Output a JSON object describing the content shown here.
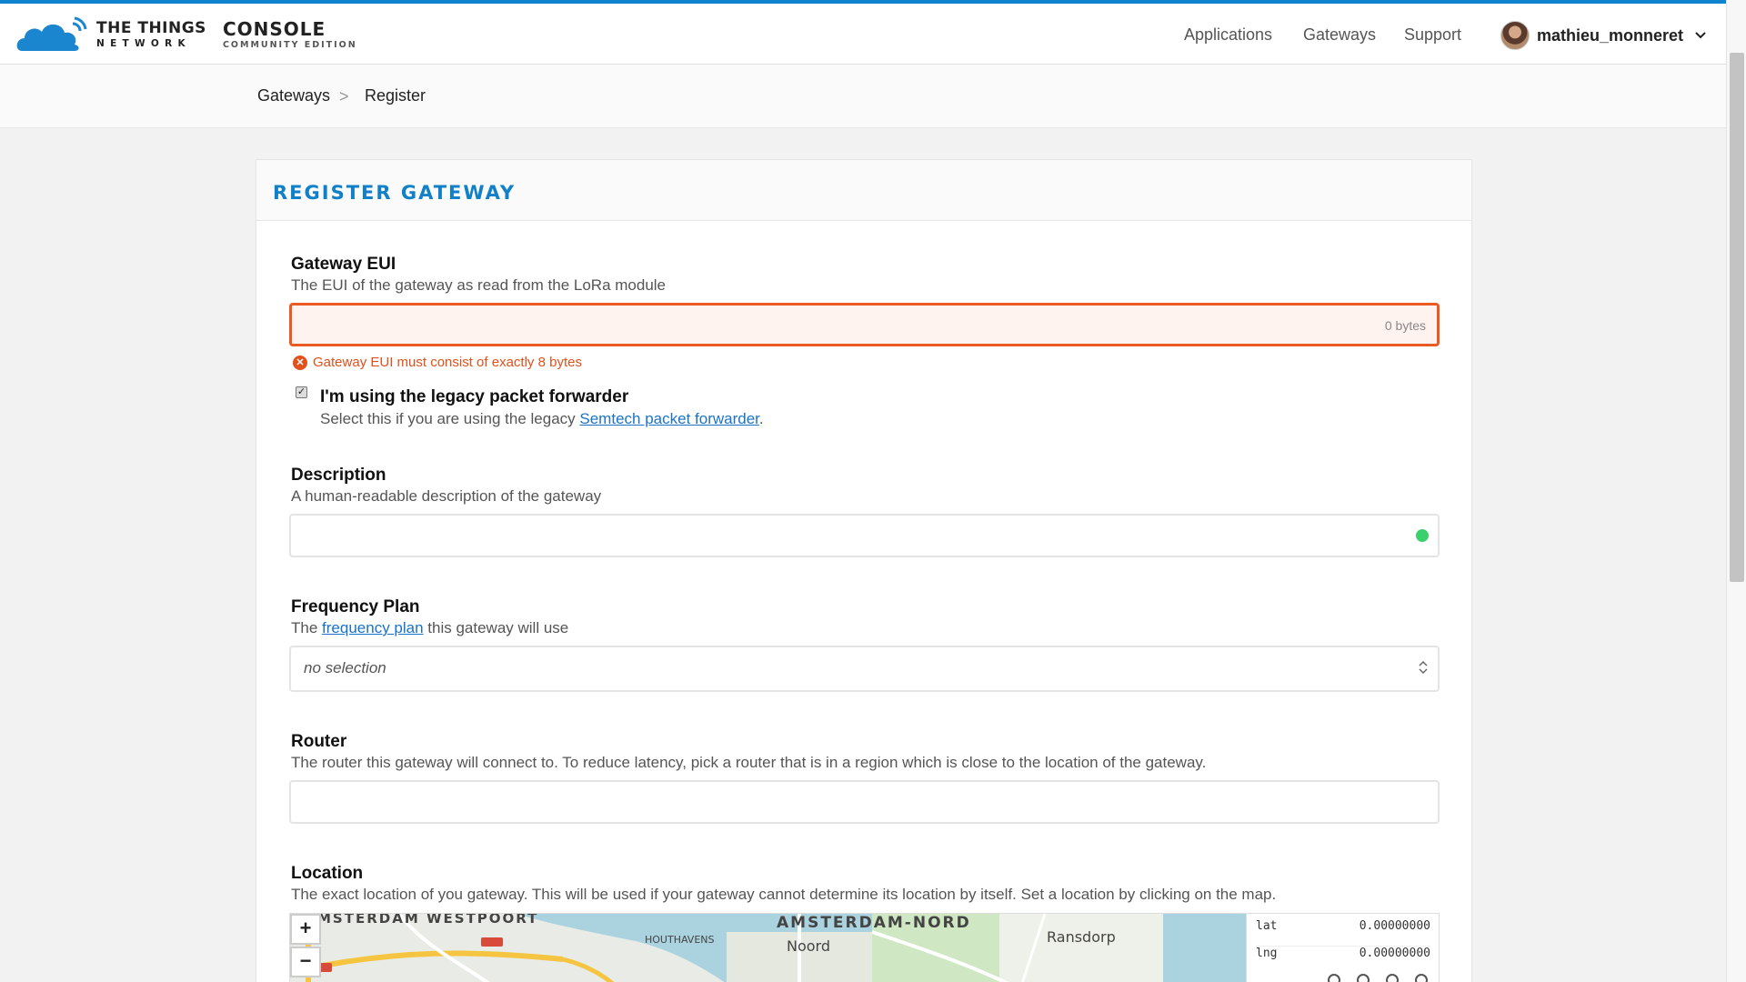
{
  "brand": {
    "name_line1": "THE THINGS",
    "name_line2": "NETWORK",
    "product_line1": "CONSOLE",
    "product_line2": "COMMUNITY EDITION",
    "accent_color": "#0d83d0"
  },
  "nav": {
    "applications": "Applications",
    "gateways": "Gateways",
    "support": "Support",
    "username": "mathieu_monneret"
  },
  "breadcrumb": {
    "items": [
      "Gateways",
      "Register"
    ],
    "separator": ">"
  },
  "card": {
    "title": "REGISTER GATEWAY"
  },
  "form": {
    "gateway_eui": {
      "label": "Gateway EUI",
      "description": "The EUI of the gateway as read from the LoRa module",
      "value": "",
      "byte_counter": "0 bytes",
      "error": "Gateway EUI must consist of exactly 8 bytes"
    },
    "legacy": {
      "checked": true,
      "label": "I'm using the legacy packet forwarder",
      "desc_before": "Select this if you are using the legacy ",
      "link": "Semtech packet forwarder",
      "desc_after": "."
    },
    "description": {
      "label": "Description",
      "description": "A human-readable description of the gateway",
      "value": ""
    },
    "frequency_plan": {
      "label": "Frequency Plan",
      "desc_before": "The ",
      "link": "frequency plan",
      "desc_after": " this gateway will use",
      "selected": "no selection"
    },
    "router": {
      "label": "Router",
      "description": "The router this gateway will connect to. To reduce latency, pick a router that is in a region which is close to the location of the gateway.",
      "value": ""
    },
    "location": {
      "label": "Location",
      "description": "The exact location of you gateway. This will be used if your gateway cannot determine its location by itself. Set a location by clicking on the map.",
      "zoom_in": "+",
      "zoom_out": "−",
      "lat_label": "lat",
      "lat_value": "0.00000000",
      "lng_label": "lng",
      "lng_value": "0.00000000",
      "map_labels": [
        "AMSTERDAM-NORD",
        "Noord",
        "Ransdorp",
        "HOUTHAVENS",
        "MSTERDAM WESTPOORT"
      ]
    }
  }
}
